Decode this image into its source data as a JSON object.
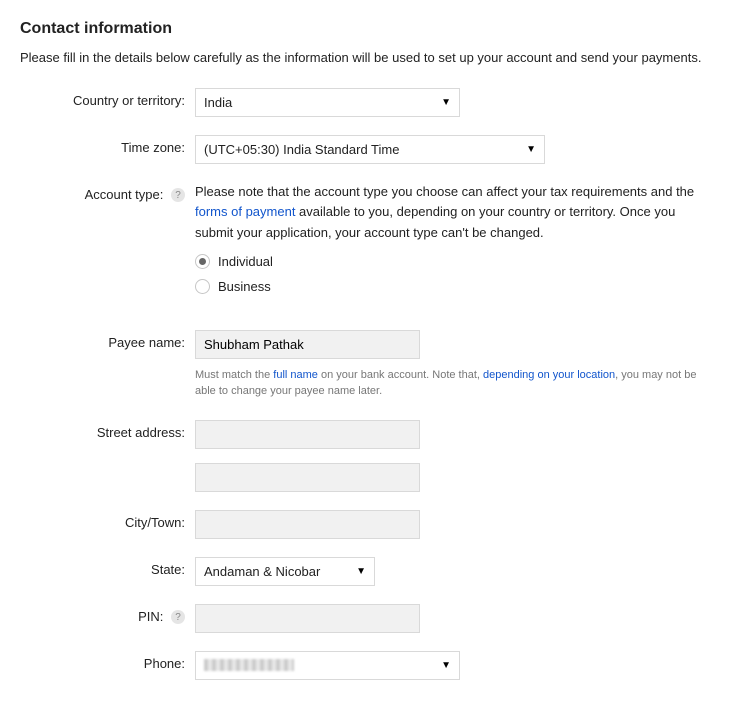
{
  "heading": "Contact information",
  "intro": "Please fill in the details below carefully as the information will be used to set up your account and send your payments.",
  "labels": {
    "country": "Country or territory:",
    "timezone": "Time zone:",
    "account_type": "Account type:",
    "payee_name": "Payee name:",
    "street_address": "Street address:",
    "city": "City/Town:",
    "state": "State:",
    "pin": "PIN:",
    "phone": "Phone:"
  },
  "values": {
    "country": "India",
    "timezone": "(UTC+05:30) India Standard Time",
    "payee_name": "Shubham Pathak",
    "street1": "",
    "street2": "",
    "city": "",
    "state": "Andaman & Nicobar",
    "pin": "",
    "phone": ""
  },
  "account_type": {
    "note_pre": "Please note that the account type you choose can affect your tax requirements and the ",
    "note_link": "forms of payment",
    "note_post": " available to you, depending on your country or territory. Once you submit your application, your account type can't be changed.",
    "options": {
      "individual": "Individual",
      "business": "Business"
    },
    "selected": "individual"
  },
  "payee_help": {
    "pre": "Must match the ",
    "link1": "full name",
    "mid": " on your bank account. Note that, ",
    "link2": "depending on your location",
    "post": ", you may not be able to change your payee name later."
  },
  "help_char": "?"
}
